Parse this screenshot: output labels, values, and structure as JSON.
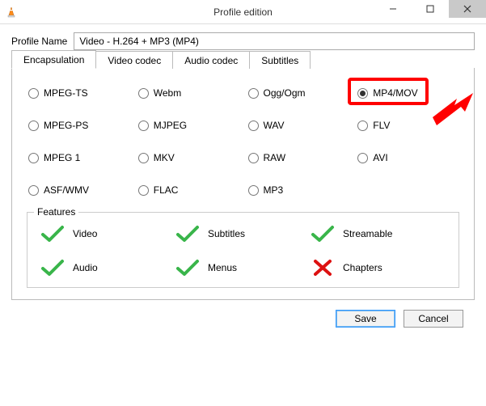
{
  "window": {
    "title": "Profile edition"
  },
  "profile": {
    "label": "Profile Name",
    "value": "Video - H.264 + MP3 (MP4)"
  },
  "tabs": [
    {
      "label": "Encapsulation"
    },
    {
      "label": "Video codec"
    },
    {
      "label": "Audio codec"
    },
    {
      "label": "Subtitles"
    }
  ],
  "encapsulation": {
    "options": [
      "MPEG-TS",
      "Webm",
      "Ogg/Ogm",
      "MP4/MOV",
      "MPEG-PS",
      "MJPEG",
      "WAV",
      "FLV",
      "MPEG 1",
      "MKV",
      "RAW",
      "AVI",
      "ASF/WMV",
      "FLAC",
      "MP3"
    ],
    "selected": "MP4/MOV"
  },
  "features": {
    "title": "Features",
    "items": [
      {
        "label": "Video",
        "ok": true
      },
      {
        "label": "Subtitles",
        "ok": true
      },
      {
        "label": "Streamable",
        "ok": true
      },
      {
        "label": "Audio",
        "ok": true
      },
      {
        "label": "Menus",
        "ok": true
      },
      {
        "label": "Chapters",
        "ok": false
      }
    ]
  },
  "buttons": {
    "save": "Save",
    "cancel": "Cancel"
  }
}
